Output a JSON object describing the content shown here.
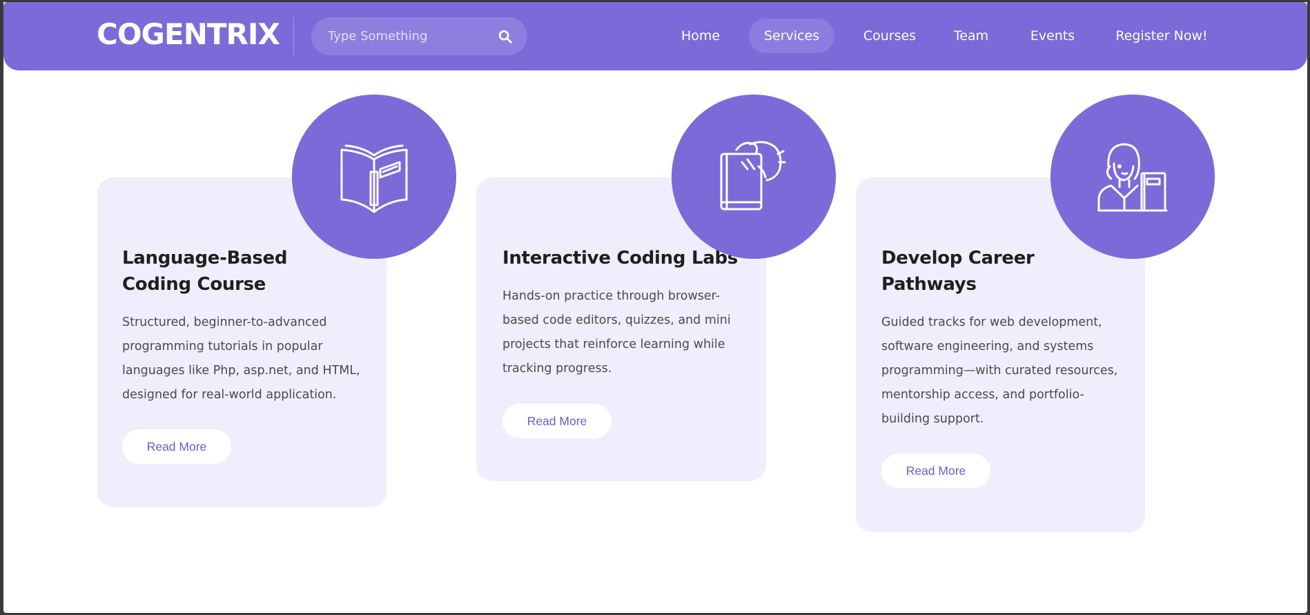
{
  "colors": {
    "accent": "#7b6ad7",
    "card_bg": "#efeefc",
    "heading": "#1f1f1f",
    "text": "#4a4a4a"
  },
  "header": {
    "logo": "COGENTRIX",
    "search": {
      "placeholder": "Type Something",
      "icon": "search-icon"
    },
    "nav": [
      {
        "label": "Home",
        "active": false
      },
      {
        "label": "Services",
        "active": true
      },
      {
        "label": "Courses",
        "active": false
      },
      {
        "label": "Team",
        "active": false
      },
      {
        "label": "Events",
        "active": false
      },
      {
        "label": "Register Now!",
        "active": false
      }
    ]
  },
  "services": [
    {
      "icon": "open-book-icon",
      "title_line1": "Language-Based",
      "title_line2": "Coding Course",
      "desc": [
        "Structured, beginner-to-advanced",
        "programming tutorials in popular",
        "languages like Php, asp.net, and HTML,",
        "designed for real-world application."
      ],
      "button": "Read More"
    },
    {
      "icon": "book-hand-icon",
      "title_line1": "Interactive Coding Labs",
      "title_line2": "",
      "desc": [
        "Hands-on practice through browser-",
        "based code editors, quizzes, and mini",
        "projects that reinforce learning while",
        "tracking progress."
      ],
      "button": "Read More"
    },
    {
      "icon": "teacher-icon",
      "title_line1": "Develop Career",
      "title_line2": "Pathways",
      "desc": [
        "Guided tracks for web development,",
        "software engineering, and systems",
        "programming—with curated resources,",
        "mentorship access, and portfolio-",
        "building support."
      ],
      "button": "Read More"
    }
  ]
}
